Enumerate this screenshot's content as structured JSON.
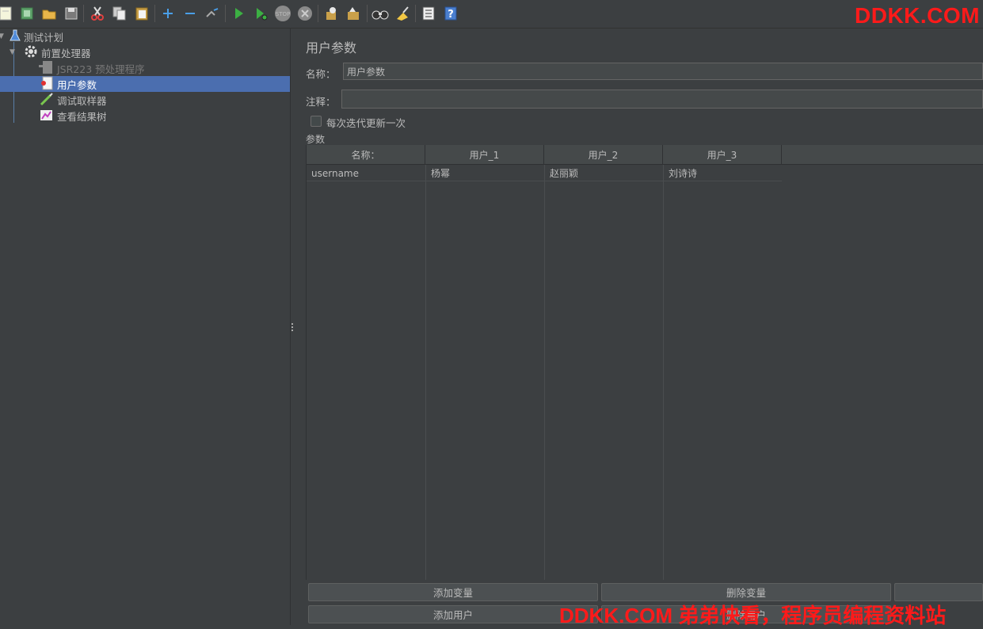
{
  "watermark": {
    "top": "DDKK.COM",
    "bottom": "DDKK.COM 弟弟快看，程序员编程资料站"
  },
  "toolbar": {
    "icons": [
      "new-icon",
      "templates-icon",
      "open-icon",
      "save-icon",
      "cut-icon",
      "copy-icon",
      "paste-icon",
      "expand-icon",
      "collapse-icon",
      "toggle-icon",
      "start-icon",
      "start-no-pause-icon",
      "stop-icon",
      "shutdown-icon",
      "clear-icon",
      "clear-all-icon",
      "search-icon",
      "reset-search-icon",
      "function-helper-icon",
      "help-icon"
    ]
  },
  "tree": {
    "items": [
      {
        "label": "测试计划",
        "icon": "flask-icon",
        "level": 0
      },
      {
        "label": "前置处理器",
        "icon": "gear-icon",
        "level": 1
      },
      {
        "label": "JSR223 预处理程序",
        "icon": "script-icon",
        "level": 2,
        "disabled": true
      },
      {
        "label": "用户参数",
        "icon": "user-params-icon",
        "level": 2,
        "selected": true
      },
      {
        "label": "调试取样器",
        "icon": "pipette-icon",
        "level": 2
      },
      {
        "label": "查看结果树",
        "icon": "chart-icon",
        "level": 2
      }
    ]
  },
  "panel": {
    "title": "用户参数",
    "name_label": "名称：",
    "name_value": "用户参数",
    "comment_label": "注释：",
    "comment_value": "",
    "checkbox_label": "每次迭代更新一次",
    "checkbox_checked": false,
    "params_label": "参数"
  },
  "table": {
    "headers": [
      "名称：",
      "用户_1",
      "用户_2",
      "用户_3"
    ],
    "rows": [
      [
        "username",
        "杨幂",
        "赵丽颖",
        "刘诗诗"
      ]
    ]
  },
  "buttons": {
    "add_variable": "添加变量",
    "delete_variable": "删除变量",
    "add_user": "添加用户",
    "delete_user": "删除用户"
  }
}
